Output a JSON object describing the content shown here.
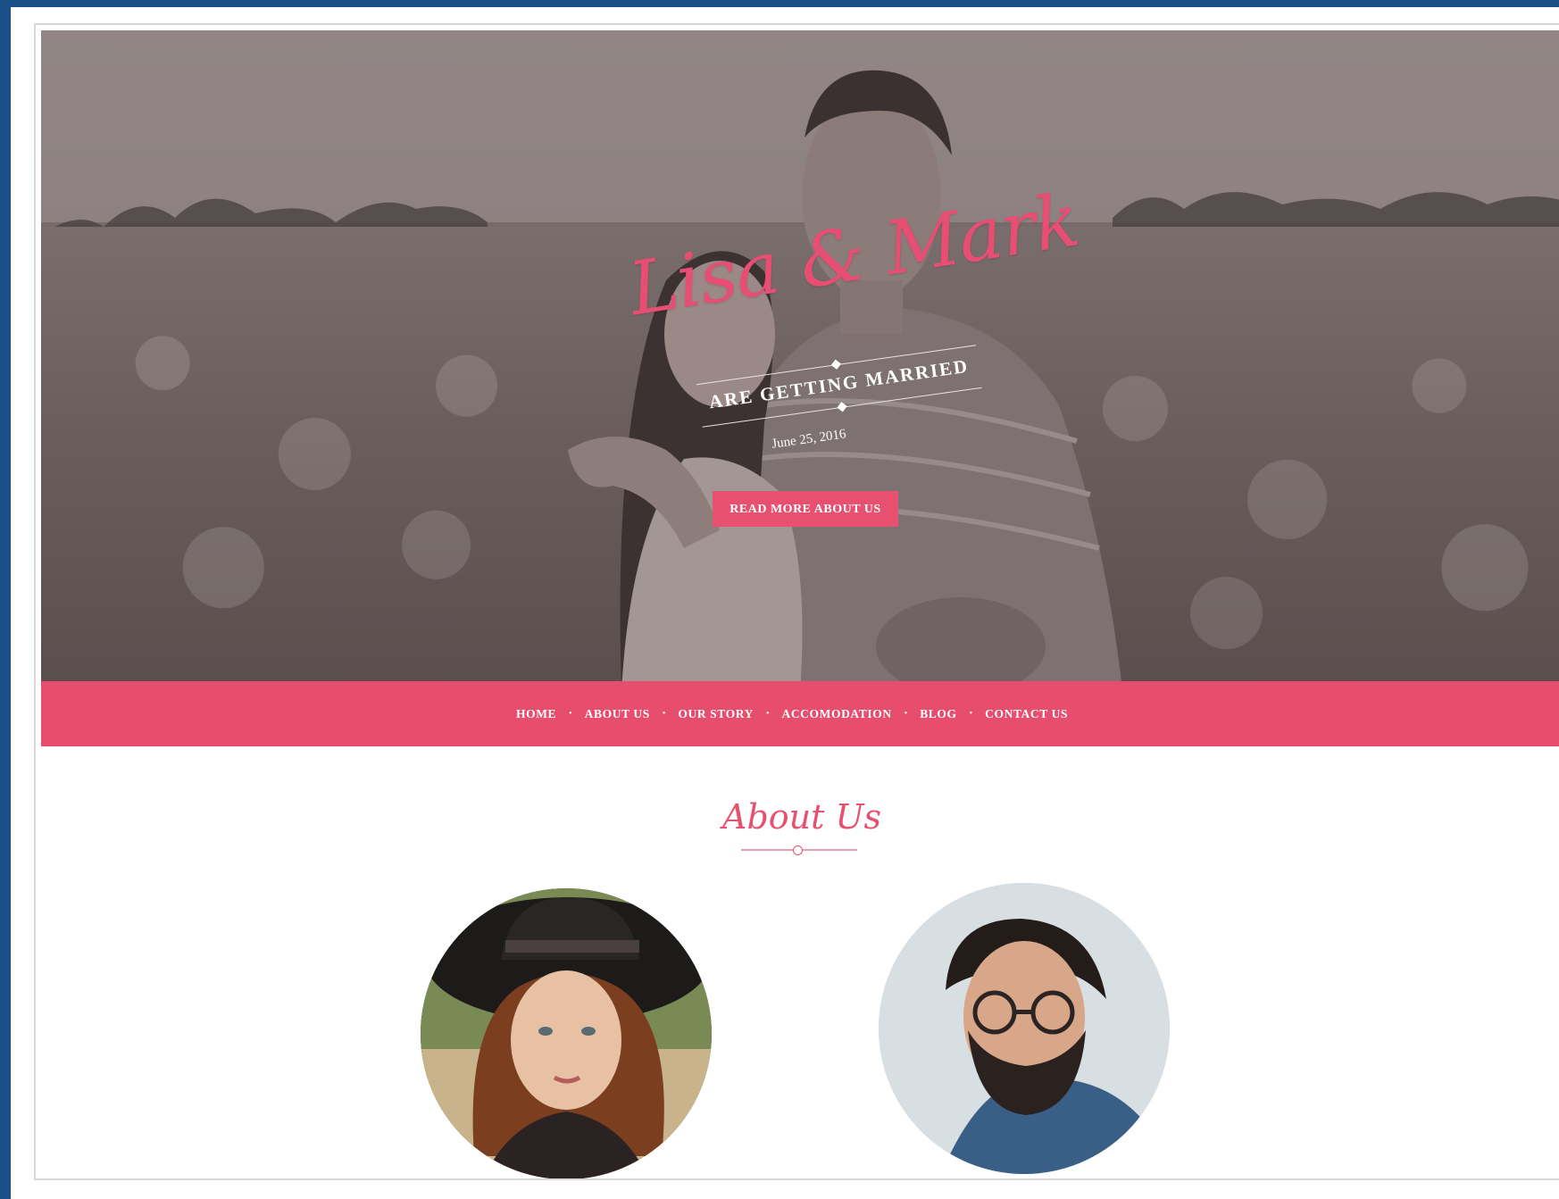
{
  "hero": {
    "title": "Lisa & Mark",
    "subtitle": "ARE GETTING MARRIED",
    "date": "June 25, 2016",
    "button_label": "READ MORE ABOUT US"
  },
  "nav": {
    "items": [
      {
        "label": "HOME"
      },
      {
        "label": "ABOUT US"
      },
      {
        "label": "OUR STORY"
      },
      {
        "label": "ACCOMODATION"
      },
      {
        "label": "BLOG"
      },
      {
        "label": "CONTACT US"
      }
    ],
    "separator": "•"
  },
  "about": {
    "title": "About Us"
  },
  "colors": {
    "accent": "#e74d6d",
    "frame": "#1a5086"
  }
}
